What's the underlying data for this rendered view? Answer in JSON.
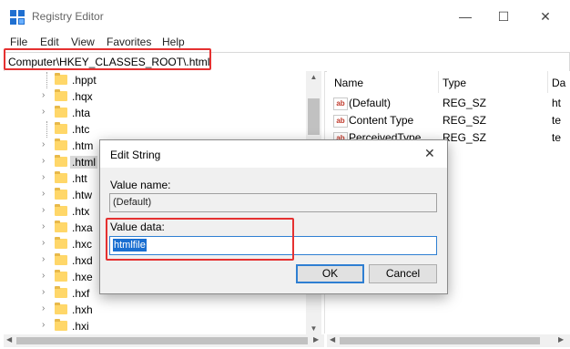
{
  "window": {
    "title": "Registry Editor",
    "min_glyph": "—",
    "max_glyph": "☐",
    "close_glyph": "✕"
  },
  "menu": [
    "File",
    "Edit",
    "View",
    "Favorites",
    "Help"
  ],
  "address": {
    "path": "Computer\\HKEY_CLASSES_ROOT\\.html"
  },
  "tree": {
    "items": [
      {
        "label": ".hppt",
        "expandable": false
      },
      {
        "label": ".hqx",
        "expandable": true
      },
      {
        "label": ".hta",
        "expandable": true
      },
      {
        "label": ".htc",
        "expandable": false
      },
      {
        "label": ".htm",
        "expandable": true
      },
      {
        "label": ".html",
        "expandable": true,
        "selected": true
      },
      {
        "label": ".htt",
        "expandable": true
      },
      {
        "label": ".htw",
        "expandable": true
      },
      {
        "label": ".htx",
        "expandable": true
      },
      {
        "label": ".hxa",
        "expandable": true
      },
      {
        "label": ".hxc",
        "expandable": true
      },
      {
        "label": ".hxd",
        "expandable": true
      },
      {
        "label": ".hxe",
        "expandable": true
      },
      {
        "label": ".hxf",
        "expandable": true
      },
      {
        "label": ".hxh",
        "expandable": true
      },
      {
        "label": ".hxi",
        "expandable": true
      }
    ]
  },
  "list": {
    "columns": {
      "name": "Name",
      "type": "Type",
      "data": "Da"
    },
    "rows": [
      {
        "name": "(Default)",
        "type": "REG_SZ",
        "data": "ht"
      },
      {
        "name": "Content Type",
        "type": "REG_SZ",
        "data": "te"
      },
      {
        "name": "PerceivedType",
        "type": "REG_SZ",
        "data": "te"
      }
    ]
  },
  "dialog": {
    "title": "Edit String",
    "value_name_label": "Value name:",
    "value_name": "(Default)",
    "value_data_label": "Value data:",
    "value_data": "htmlfile",
    "ok_label": "OK",
    "cancel_label": "Cancel",
    "close_glyph": "✕"
  },
  "colors": {
    "highlight_box": "#e53131",
    "selection": "#1a6fd1",
    "folder": "#ffd769"
  }
}
